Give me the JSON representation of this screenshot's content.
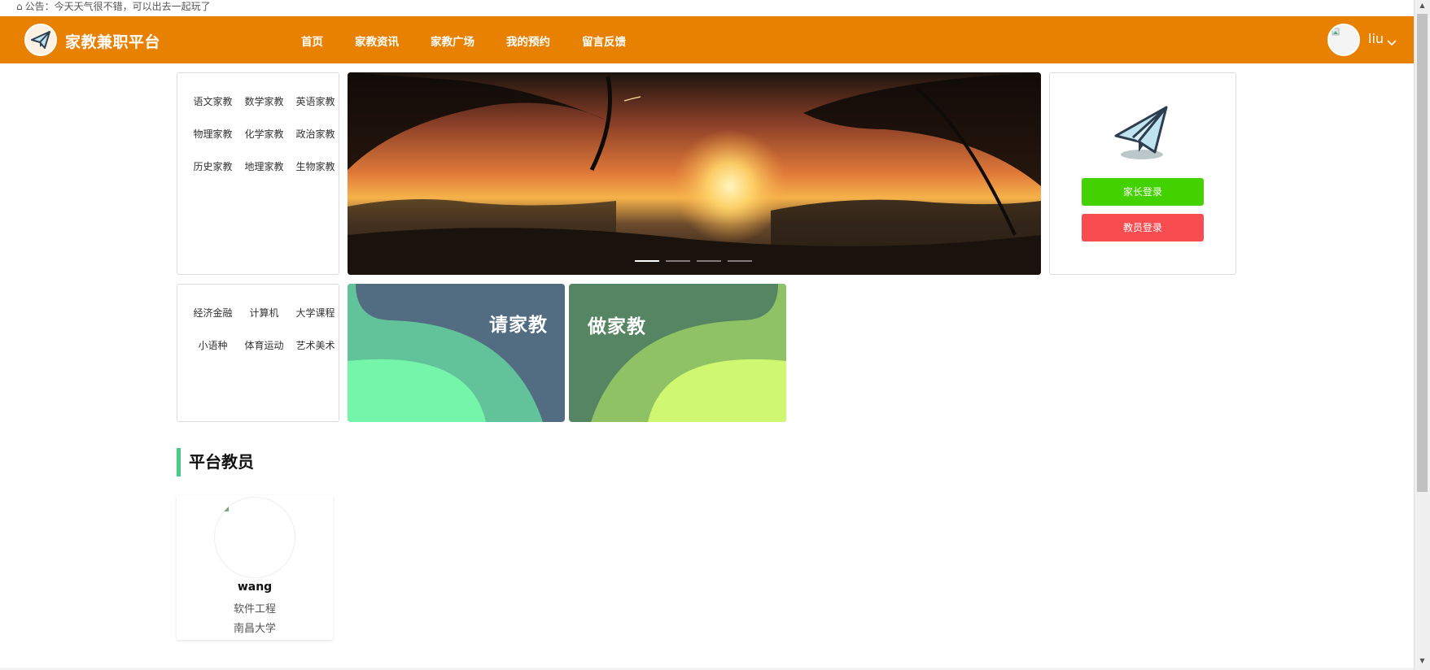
{
  "notice": {
    "icon": "home-icon",
    "text": "公告：今天天气很不错，可以出去一起玩了"
  },
  "header": {
    "bg_color": "#E88002",
    "site_title": "家教兼职平台",
    "logo_icon": "paper-plane-logo-icon",
    "nav": [
      "首页",
      "家教资讯",
      "家教广场",
      "我的预约",
      "留言反馈"
    ],
    "user": {
      "name": "liu",
      "avatar_icon": "user-avatar-icon",
      "dropdown_icon": "chevron-down-icon"
    }
  },
  "categories_top": [
    "语文家教",
    "数学家教",
    "英语家教",
    "物理家教",
    "化学家教",
    "政治家教",
    "历史家教",
    "地理家教",
    "生物家教"
  ],
  "categories_bottom": [
    "经济金融",
    "计算机",
    "大学课程",
    "小语种",
    "体育运动",
    "艺术美术"
  ],
  "banner": {
    "image": "tropical-sunset-image",
    "slide_count": 4,
    "active_slide": 1
  },
  "login": {
    "icon": "paper-plane-icon",
    "parent_login": "家长登录",
    "teacher_login": "教员登录",
    "parent_color": "#43D200",
    "teacher_color": "#F74C50"
  },
  "promos": [
    {
      "label": "请家教",
      "colors": [
        "#526D82",
        "#62C39B",
        "#75F5A9"
      ]
    },
    {
      "label": "做家教",
      "colors": [
        "#558562",
        "#8FC264",
        "#CFF771"
      ]
    }
  ],
  "teachers_section": {
    "title": "平台教员",
    "accent_color": "#44CC88",
    "teachers": [
      {
        "name": "wang",
        "major": "软件工程",
        "school": "南昌大学"
      }
    ]
  }
}
